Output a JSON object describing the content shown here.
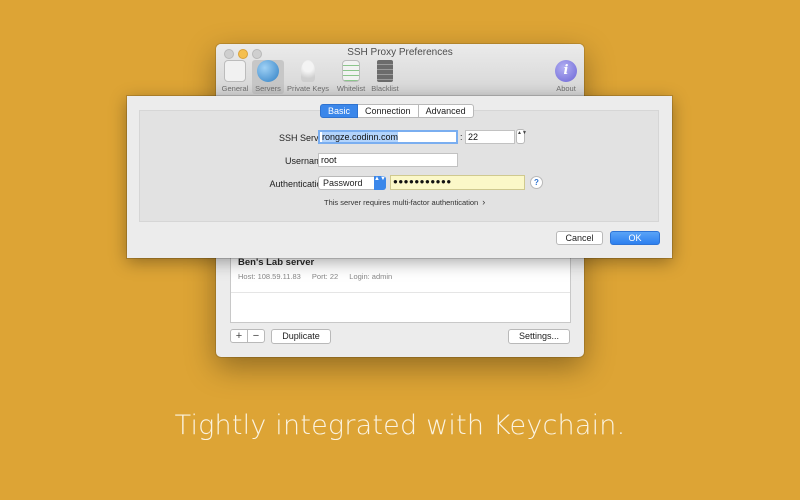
{
  "background_color": "#dda435",
  "window": {
    "title": "SSH Proxy Preferences",
    "toolbar": [
      {
        "label": "General",
        "icon": "general-switch-icon"
      },
      {
        "label": "Servers",
        "icon": "globe-icon"
      },
      {
        "label": "Private Keys",
        "icon": "key-icon"
      },
      {
        "label": "Whitelist",
        "icon": "whitelist-icon"
      },
      {
        "label": "Blacklist",
        "icon": "blacklist-icon"
      },
      {
        "label": "About",
        "icon": "info-icon",
        "glyph": "i"
      }
    ],
    "servers": [
      {
        "name": "Ben's Lab server",
        "host": "Host: 108.59.11.83",
        "port": "Port: 22",
        "login": "Login: admin"
      }
    ],
    "buttons": {
      "add": "+",
      "remove": "−",
      "duplicate": "Duplicate",
      "settings": "Settings..."
    }
  },
  "sheet": {
    "tabs": [
      "Basic",
      "Connection",
      "Advanced"
    ],
    "active_tab": "Basic",
    "labels": {
      "ssh_server": "SSH Server:",
      "username": "Username:",
      "authentication": "Authentication:"
    },
    "fields": {
      "host": "rongze.codinn.com",
      "colon": ":",
      "port": "22",
      "stepper": "▲▼",
      "username": "root",
      "auth_method": "Password",
      "popup_arrows": "▲▼",
      "password_mask": "●●●●●●●●●●●",
      "help": "?"
    },
    "mfa_note": "This server requires multi-factor authentication",
    "mfa_chevron": "›",
    "cancel": "Cancel",
    "ok": "OK",
    "accent_color": "#3b87ea"
  },
  "tagline": "Tightly integrated with Keychain."
}
